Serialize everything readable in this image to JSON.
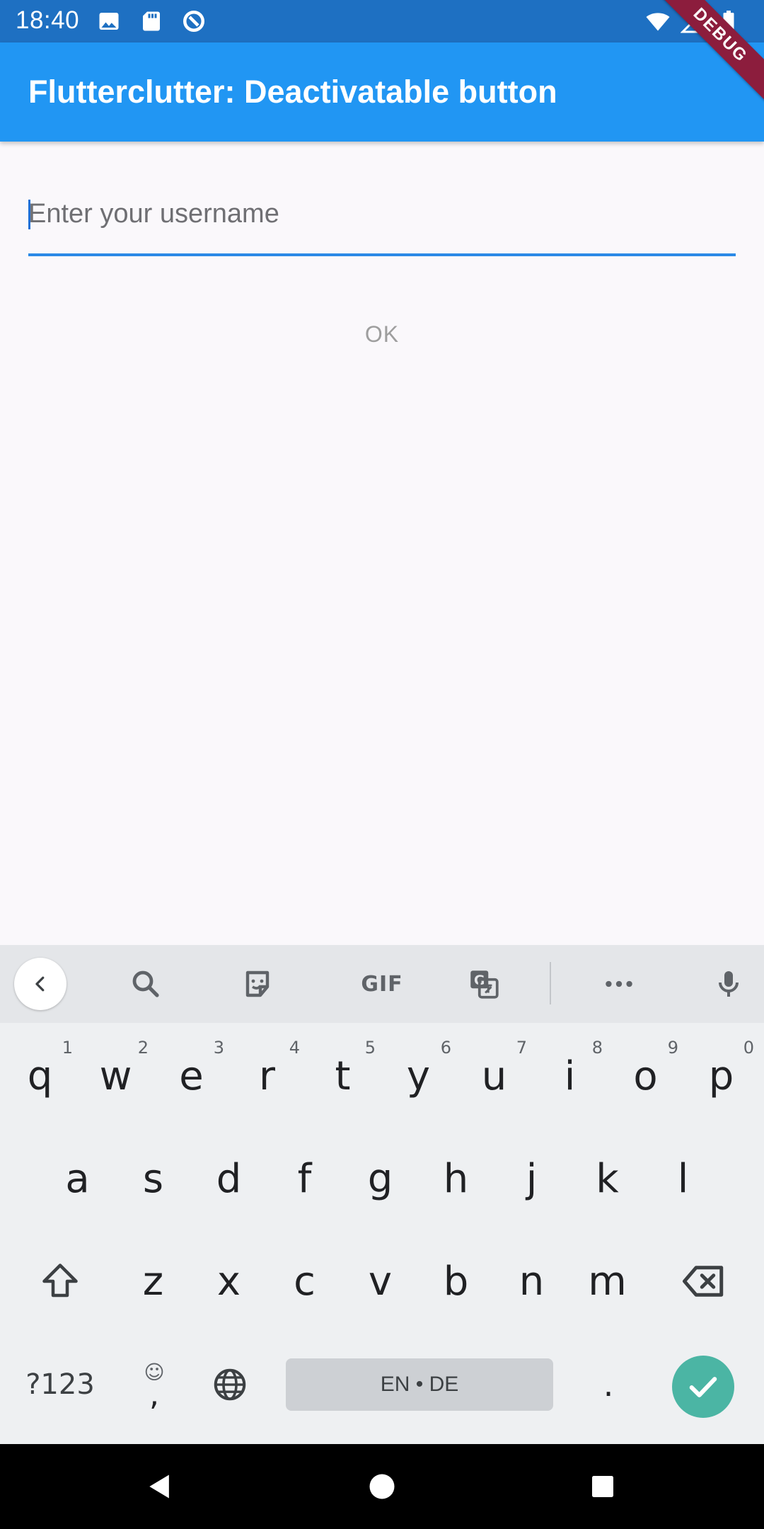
{
  "status_bar": {
    "time": "18:40",
    "left_icons": [
      "image-icon",
      "sd-card-icon",
      "sync-icon"
    ],
    "right_icons": [
      "wifi-icon",
      "cell-signal-icon",
      "battery-icon"
    ]
  },
  "debug_banner": "DEBUG",
  "app_bar": {
    "title": "Flutterclutter: Deactivatable button"
  },
  "form": {
    "username_placeholder": "Enter your username",
    "username_value": "",
    "ok_label": "OK"
  },
  "keyboard": {
    "toolbar": [
      "back-icon",
      "search-icon",
      "sticker-icon",
      "gif",
      "translate-icon",
      "more-icon",
      "mic-icon"
    ],
    "gif_label": "GIF",
    "row1": [
      {
        "k": "q",
        "h": "1"
      },
      {
        "k": "w",
        "h": "2"
      },
      {
        "k": "e",
        "h": "3"
      },
      {
        "k": "r",
        "h": "4"
      },
      {
        "k": "t",
        "h": "5"
      },
      {
        "k": "y",
        "h": "6"
      },
      {
        "k": "u",
        "h": "7"
      },
      {
        "k": "i",
        "h": "8"
      },
      {
        "k": "o",
        "h": "9"
      },
      {
        "k": "p",
        "h": "0"
      }
    ],
    "row2": [
      "a",
      "s",
      "d",
      "f",
      "g",
      "h",
      "j",
      "k",
      "l"
    ],
    "row3": [
      "z",
      "x",
      "c",
      "v",
      "b",
      "n",
      "m"
    ],
    "symbols_label": "?123",
    "emoji_label": "☺",
    "comma_label": ",",
    "space_label": "EN • DE",
    "period_label": ".",
    "accent_color": "#4bb5a4"
  },
  "nav": [
    "back-triangle-icon",
    "home-circle-icon",
    "recents-square-icon"
  ]
}
